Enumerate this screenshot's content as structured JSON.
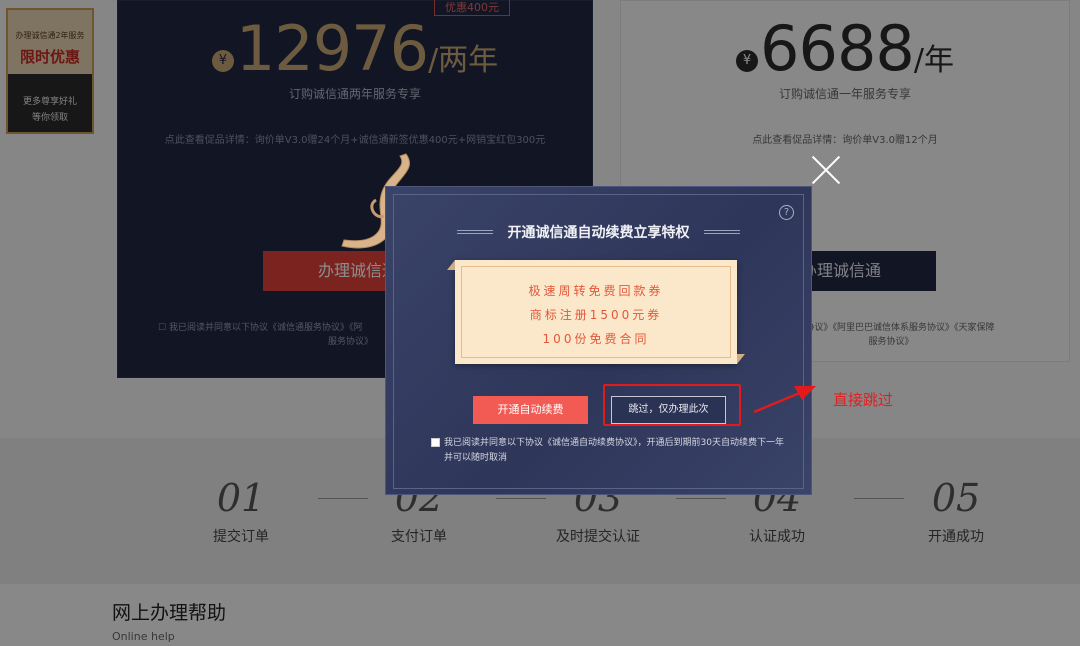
{
  "background": {
    "badge": {
      "line1": "办理诚信通2年服务",
      "line2": "限时优惠",
      "line3": "更多尊享好礼",
      "line4": "等你领取"
    },
    "two_year": {
      "discount_tag": "优惠400元",
      "yen": "¥",
      "price": "12976",
      "unit": "/两年",
      "subtitle": "订购诚信通两年服务专享",
      "promo": "点此查看促品详情：询价单V3.0赠24个月+诚信通新签优惠400元+网销宝红包300元",
      "button": "办理诚信通",
      "agreement": "我已阅读并同意以下协议《诚信通服务协议》《阿",
      "agreement2": "服务协议》"
    },
    "one_year": {
      "yen": "¥",
      "price": "6688",
      "unit": "/年",
      "subtitle": "订购诚信通一年服务专享",
      "promo": "点此查看促品详情：询价单V3.0赠12个月",
      "button": "办理诚信通",
      "agreement": "服务协议》《阿里巴巴诚信体系服务协议》《天家保障",
      "agreement2": "服务协议》"
    },
    "steps": [
      {
        "num": "01",
        "label": "提交订单"
      },
      {
        "num": "02",
        "label": "支付订单"
      },
      {
        "num": "03",
        "label": "及时提交认证"
      },
      {
        "num": "04",
        "label": "认证成功"
      },
      {
        "num": "05",
        "label": "开通成功"
      }
    ],
    "help": {
      "title": "网上办理帮助",
      "subtitle": "Online help"
    }
  },
  "modal": {
    "help_icon": "?",
    "title": "开通诚信通自动续费立享特权",
    "benefits": [
      "极速周转免费回款券",
      "商标注册1500元券",
      "100份免费合同"
    ],
    "primary_button": "开通自动续费",
    "skip_button": "跳过，仅办理此次",
    "agreement": "我已阅读并同意以下协议《诚信通自动续费协议》，开通后到期前30天自动续费下一年并可以随时取消"
  },
  "annotation": {
    "text": "直接跳过",
    "color": "#e31f1f"
  },
  "colors": {
    "gold": "#c7a675",
    "navy": "#1f2742",
    "cta_red": "#f25b54"
  }
}
